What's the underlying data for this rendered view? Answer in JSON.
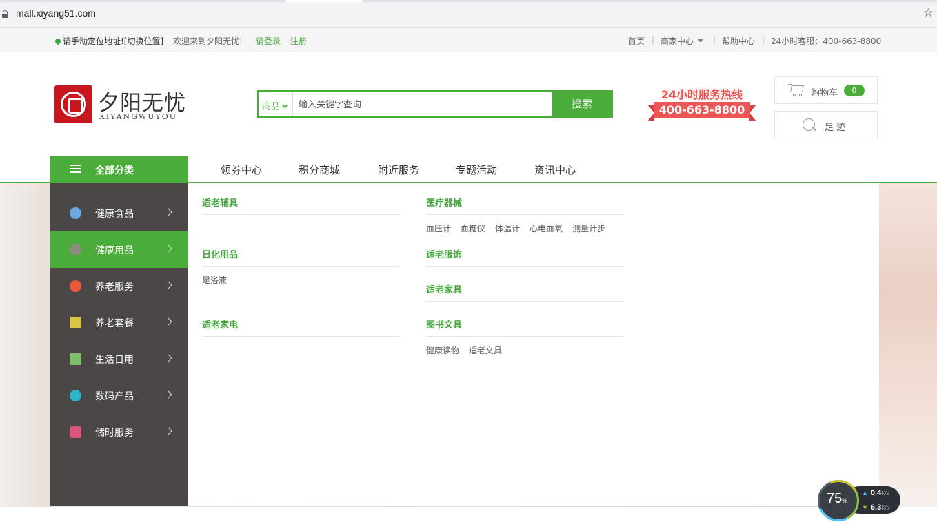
{
  "browser": {
    "url": "mall.xiyang51.com"
  },
  "topbar": {
    "location": "请手动定位地址![切换位置]",
    "welcome": "欢迎来到夕阳无忧!",
    "login": "请登录",
    "register": "注册",
    "home": "首页",
    "merchant": "商家中心",
    "help": "帮助中心",
    "service": "24小时客服：400-663-8800"
  },
  "header": {
    "logo_name": "夕阳无忧",
    "logo_en": "XIYANGWUYOU",
    "search": {
      "category": "商品",
      "placeholder": "输入关键字查询",
      "button": "搜索"
    },
    "hotline_title": "24小时服务热线",
    "hotline_number": "400-663-8800",
    "cart_label": "购物车",
    "cart_count": "0",
    "footprint_label": "足迹"
  },
  "nav": {
    "all_categories": "全部分类",
    "links": [
      "领券中心",
      "积分商城",
      "附近服务",
      "专题活动",
      "资讯中心"
    ]
  },
  "sidebar": {
    "items": [
      {
        "label": "健康食品",
        "icon": "health-food-icon",
        "color": "#6ba7e0"
      },
      {
        "label": "健康用品",
        "icon": "health-goods-icon",
        "color": "#8a8d80"
      },
      {
        "label": "养老服务",
        "icon": "elderly-service-icon",
        "color": "#e55a3c"
      },
      {
        "label": "养老套餐",
        "icon": "package-icon",
        "color": "#d9c24a"
      },
      {
        "label": "生活日用",
        "icon": "daily-use-icon",
        "color": "#7fbf6a"
      },
      {
        "label": "数码产品",
        "icon": "digital-icon",
        "color": "#2fb3c9"
      },
      {
        "label": "储时服务",
        "icon": "calendar-icon",
        "color": "#d9577c"
      }
    ]
  },
  "panel": {
    "groups": [
      {
        "title": "适老辅具",
        "items": []
      },
      {
        "title": "日化用品",
        "items": [
          "足浴液"
        ]
      },
      {
        "title": "适老家电",
        "items": []
      },
      {
        "title": "医疗器械",
        "items": [
          "血压计",
          "血糖仪",
          "体温计",
          "心电血氧",
          "测量计步"
        ]
      },
      {
        "title": "适老服饰",
        "items": []
      },
      {
        "title": "适老家具",
        "items": []
      },
      {
        "title": "图书文具",
        "items": [
          "健康读物",
          "适老文具"
        ]
      }
    ]
  },
  "speed_widget": {
    "percent": "75",
    "percent_unit": "%",
    "upload": "0.4",
    "download": "6.3",
    "unit": "K/s"
  },
  "colors": {
    "brand_green": "#4aad3a",
    "sidebar_bg": "#4a4746",
    "logo_red": "#c8161e",
    "hotline_red": "#ec5656"
  }
}
